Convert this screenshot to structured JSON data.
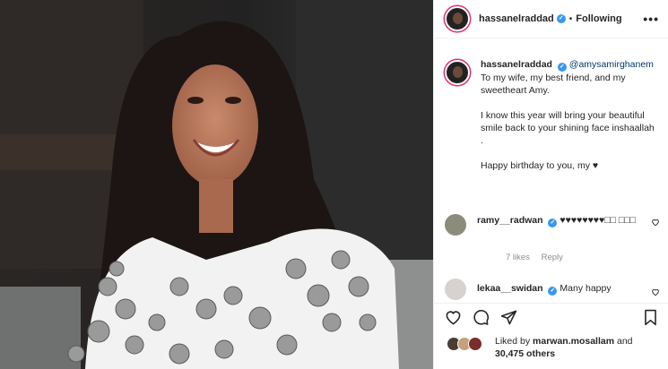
{
  "post": {
    "author": "hassanelraddad",
    "follow_status": "Following",
    "separator": "•",
    "more_label": "•••"
  },
  "caption": {
    "author": "hassanelraddad",
    "mention": "@amysamirghanem",
    "line1": "To my wife, my best friend, and my sweetheart Amy.",
    "line2": "I know this year will bring your beautiful smile back to your shining face inshaallah .",
    "line3": "Happy birthday to you, my ♥"
  },
  "comments": [
    {
      "author": "ramy__radwan",
      "text": "♥♥♥♥♥♥♥♥□□ □□□",
      "likes": "7 likes",
      "reply": "Reply"
    },
    {
      "author": "lekaa__swidan",
      "text": "Many happy"
    }
  ],
  "likes": {
    "prefix": "Liked by ",
    "user": "marwan.mosallam",
    "middle": " and",
    "count": "30,475 others"
  },
  "icons": {
    "like": "heart-icon",
    "comment": "comment-icon",
    "share": "share-icon",
    "save": "bookmark-icon",
    "verified": "verified-badge-icon"
  },
  "colors": {
    "verified": "#3897f0",
    "story_ring": "#e1306c",
    "link": "#00376b",
    "muted": "#8e8e8e"
  }
}
